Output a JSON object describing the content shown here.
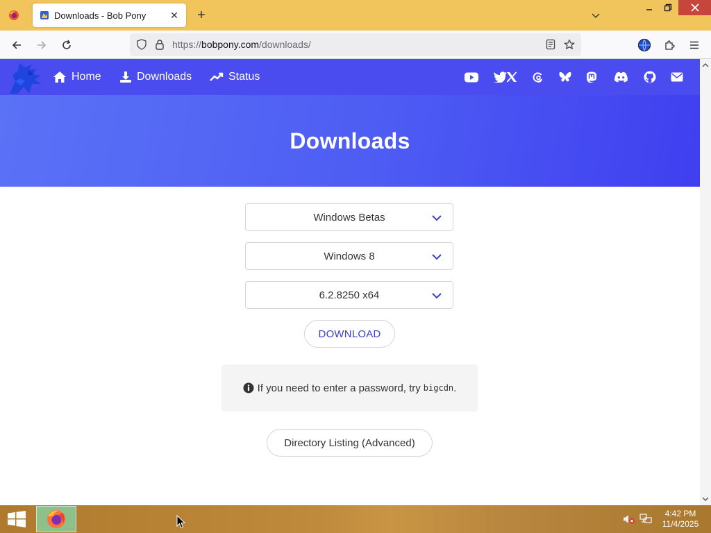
{
  "browser": {
    "tab_title": "Downloads - Bob Pony",
    "url_scheme": "https://",
    "url_host": "bobpony.com",
    "url_path": "/downloads/",
    "titlebar_color": "#f2c55c"
  },
  "site": {
    "nav": [
      {
        "label": "Home",
        "icon": "home-icon"
      },
      {
        "label": "Downloads",
        "icon": "download-icon"
      },
      {
        "label": "Status",
        "icon": "trend-icon"
      }
    ],
    "social_icons": [
      "youtube-icon",
      "twitter-icon",
      "x-icon",
      "threads-icon",
      "bluesky-icon",
      "mastodon-icon",
      "discord-icon",
      "github-icon",
      "mail-icon"
    ],
    "brand_color": "#4a4cf0"
  },
  "main": {
    "heading": "Downloads",
    "selects": [
      {
        "value": "Windows Betas"
      },
      {
        "value": "Windows 8"
      },
      {
        "value": "6.2.8250 x64"
      }
    ],
    "download_label": "DOWNLOAD",
    "notice_text": "If you need to enter a password, try",
    "notice_code": "bigcdn",
    "notice_end": ".",
    "directory_label": "Directory Listing (Advanced)"
  },
  "taskbar": {
    "time": "4:42 PM",
    "date": "11/4/2025"
  }
}
